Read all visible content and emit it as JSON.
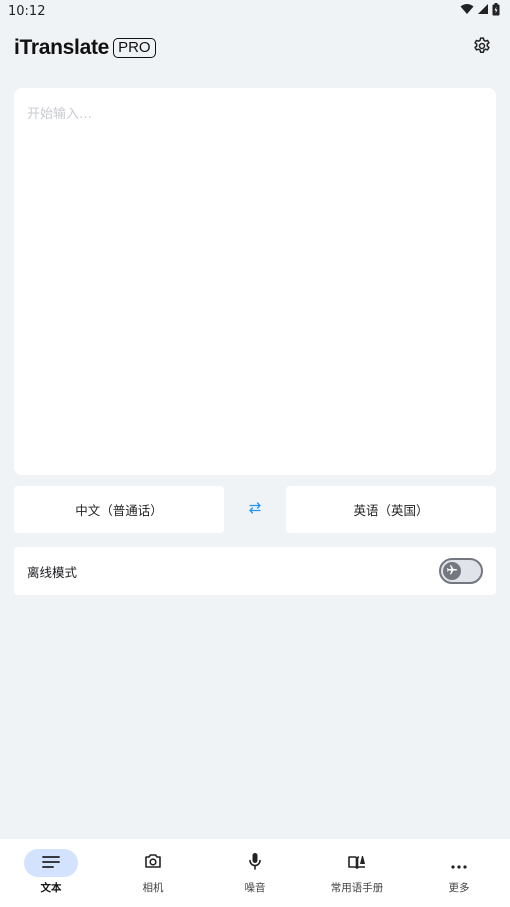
{
  "status_bar": {
    "time": "10:12",
    "icons": [
      "wifi-icon",
      "cellular-signal-icon",
      "battery-icon"
    ]
  },
  "header": {
    "app_name": "iTranslate",
    "badge": "PRO",
    "settings_icon": "gear-icon"
  },
  "input": {
    "placeholder": "开始输入…",
    "value": ""
  },
  "languages": {
    "source": "中文（普通话）",
    "target": "英语（英国）",
    "swap_icon": "swap-arrows-icon"
  },
  "offline": {
    "label": "离线模式",
    "enabled": false,
    "toggle_icon": "airplane-icon"
  },
  "bottom_nav": {
    "items": [
      {
        "label": "文本",
        "icon": "text-lines-icon",
        "active": true
      },
      {
        "label": "相机",
        "icon": "camera-icon",
        "active": false
      },
      {
        "label": "噪音",
        "icon": "microphone-icon",
        "active": false
      },
      {
        "label": "常用语手册",
        "icon": "phrasebook-icon",
        "active": false
      },
      {
        "label": "更多",
        "icon": "more-dots-icon",
        "active": false
      }
    ]
  },
  "colors": {
    "background": "#f0f3f6",
    "surface": "#ffffff",
    "accent": "#2196f3",
    "active_nav_pill": "#d3e3fd",
    "placeholder": "#c8cbd0"
  }
}
